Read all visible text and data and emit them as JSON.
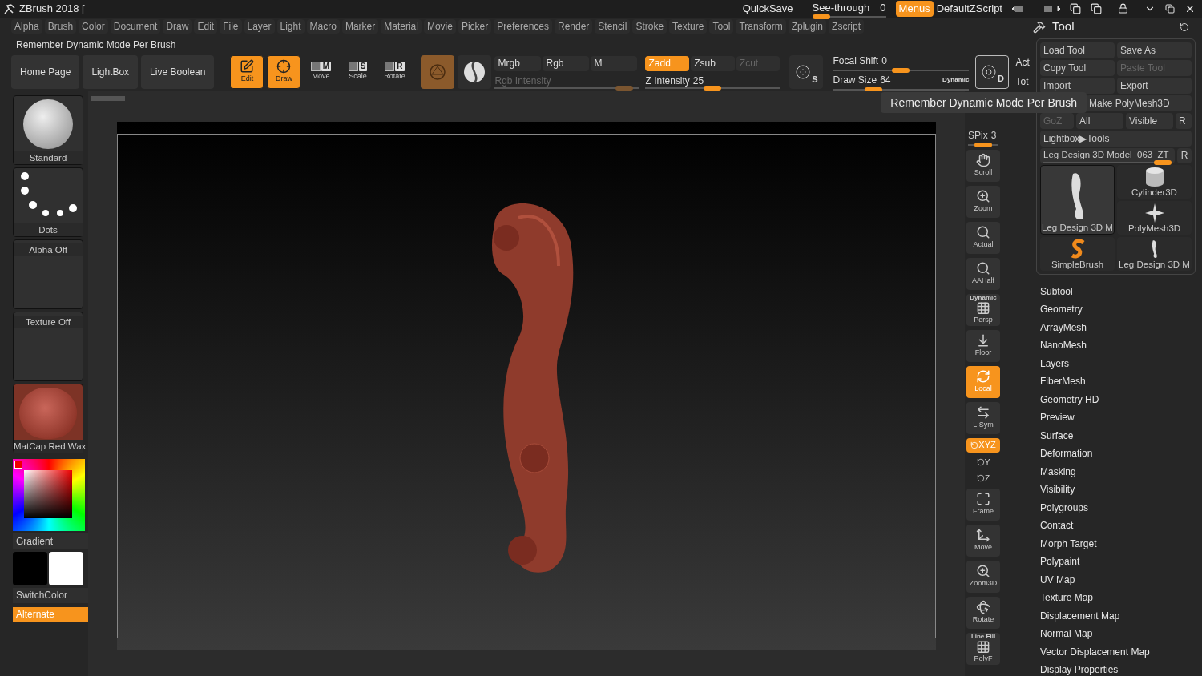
{
  "title_bar": {
    "title": "ZBrush 2018 [",
    "quick_save": "QuickSave",
    "see_through": {
      "label": "See-through",
      "reading": "0",
      "level": 0
    },
    "menus": {
      "label": "Menus",
      "selected": true
    },
    "script": "DefaultZScript"
  },
  "menu_bar": [
    "Alpha",
    "Brush",
    "Color",
    "Document",
    "Draw",
    "Edit",
    "File",
    "Layer",
    "Light",
    "Macro",
    "Marker",
    "Material",
    "Movie",
    "Picker",
    "Preferences",
    "Render",
    "Stencil",
    "Stroke",
    "Texture",
    "Tool",
    "Transform",
    "Zplugin",
    "Zscript"
  ],
  "info_text": "Remember Dynamic Mode Per Brush",
  "toolbar": {
    "buttons": [
      "Home Page",
      "LightBox",
      "Live Boolean"
    ],
    "modes": [
      {
        "label": "Edit",
        "kind": "edit",
        "selected": true
      },
      {
        "label": "Draw",
        "kind": "draw",
        "selected": true
      },
      {
        "label": "Move",
        "kind": "transform",
        "key": "M",
        "selected": false
      },
      {
        "label": "Scale",
        "kind": "transform",
        "key": "S",
        "selected": false
      },
      {
        "label": "Rotate",
        "kind": "transform",
        "key": "R",
        "selected": false
      }
    ],
    "channels": [
      {
        "label": "Mrgb",
        "selected": false
      },
      {
        "label": "Rgb",
        "selected": false
      },
      {
        "label": "M",
        "selected": false
      }
    ],
    "rgb_intensity": {
      "label": "Rgb Intensity",
      "disabled": true,
      "level": 0.95
    },
    "sculpt_modes": [
      {
        "label": "Zadd",
        "selected": true,
        "disabled": false
      },
      {
        "label": "Zsub",
        "selected": false,
        "disabled": false
      },
      {
        "label": "Zcut",
        "selected": false,
        "disabled": true
      }
    ],
    "z_intensity": {
      "label": "Z Intensity",
      "reading": "25",
      "level": 0.5
    },
    "brush_key": "S",
    "focal_shift": {
      "label": "Focal Shift",
      "reading": "0",
      "level": 0.5
    },
    "draw_size": {
      "label": "Draw Size",
      "reading": "64",
      "level": 0.27
    },
    "dynamic_label": "Dynamic",
    "dynamic_key": "D",
    "act": "Act",
    "tot": "Tot"
  },
  "left_shelf": {
    "items": [
      {
        "label": "Standard",
        "kind": "brush"
      },
      {
        "label": "Dots",
        "kind": "stroke"
      },
      {
        "label": "Alpha Off",
        "kind": "empty"
      },
      {
        "label": "Texture Off",
        "kind": "empty"
      },
      {
        "label": "MatCap Red Wax",
        "kind": "material"
      }
    ],
    "gradient": "Gradient",
    "switch_color": "SwitchColor",
    "alternate": {
      "label": "Alternate",
      "selected": true
    }
  },
  "tooltip": "Remember Dynamic Mode Per Brush",
  "right_shelf": {
    "spix": {
      "label": "SPix",
      "reading": "3",
      "level": 0.5
    },
    "items": [
      {
        "label": "Scroll",
        "kind": "scroll",
        "on": false
      },
      {
        "label": "Zoom",
        "kind": "zoom",
        "on": false
      },
      {
        "label": "Actual",
        "kind": "actual",
        "on": false
      },
      {
        "label": "AAHalf",
        "kind": "aahalf",
        "on": false
      },
      {
        "label": "Persp",
        "kind": "persp",
        "header": "Dynamic",
        "on": false
      },
      {
        "label": "Floor",
        "kind": "floor",
        "on": false
      },
      {
        "label": "Local",
        "kind": "local",
        "on": true
      },
      {
        "label": "L.Sym",
        "kind": "lsym",
        "on": false
      },
      {
        "label": "XYZ",
        "kind": "axis",
        "on": true
      },
      {
        "label": "Y",
        "kind": "axis_small",
        "on": false
      },
      {
        "label": "Z",
        "kind": "axis_small",
        "on": false
      },
      {
        "label": "Frame",
        "kind": "frame",
        "on": false
      },
      {
        "label": "Move",
        "kind": "move",
        "on": false
      },
      {
        "label": "Zoom3D",
        "kind": "zoom",
        "on": false
      },
      {
        "label": "Rotate",
        "kind": "rotate",
        "on": false
      },
      {
        "label": "PolyF",
        "kind": "polyf",
        "header": "Line Fill",
        "on": false
      }
    ]
  },
  "tool_panel": {
    "title": "Tool",
    "buttons": [
      {
        "label": "Load Tool",
        "disabled": false
      },
      {
        "label": "Save As",
        "disabled": false
      },
      {
        "label": "Copy Tool",
        "disabled": false
      },
      {
        "label": "Paste Tool",
        "disabled": true
      },
      {
        "label": "Import",
        "disabled": false
      },
      {
        "label": "Export",
        "disabled": false
      }
    ],
    "make_polymesh": "Make PolyMesh3D",
    "goz_row": [
      {
        "label": "GoZ",
        "disabled": true
      },
      {
        "label": "All",
        "disabled": false
      },
      {
        "label": "Visible",
        "disabled": false
      },
      {
        "label": "R",
        "disabled": false
      }
    ],
    "lightbox": "Lightbox▶Tools",
    "current_tool": {
      "name": "Leg Design 3D Model_063_ZT",
      "level": 1,
      "r": "R"
    },
    "thumbnails": [
      {
        "label": "Leg Design 3D M",
        "kind": "leg",
        "selected": true
      },
      {
        "label": "SimpleBrush",
        "kind": "brush",
        "selected": false
      },
      {
        "label": "Cylinder3D",
        "kind": "cylinder",
        "selected": false
      },
      {
        "label": "PolyMesh3D",
        "kind": "star",
        "selected": false
      },
      {
        "label": "Leg Design 3D M",
        "kind": "leg",
        "selected": false
      }
    ],
    "subpalettes": [
      "Subtool",
      "Geometry",
      "ArrayMesh",
      "NanoMesh",
      "Layers",
      "FiberMesh",
      "Geometry HD",
      "Preview",
      "Surface",
      "Deformation",
      "Masking",
      "Visibility",
      "Polygroups",
      "Contact",
      "Morph Target",
      "Polypaint",
      "UV Map",
      "Texture Map",
      "Displacement Map",
      "Normal Map",
      "Vector Displacement Map",
      "Display Properties"
    ]
  }
}
